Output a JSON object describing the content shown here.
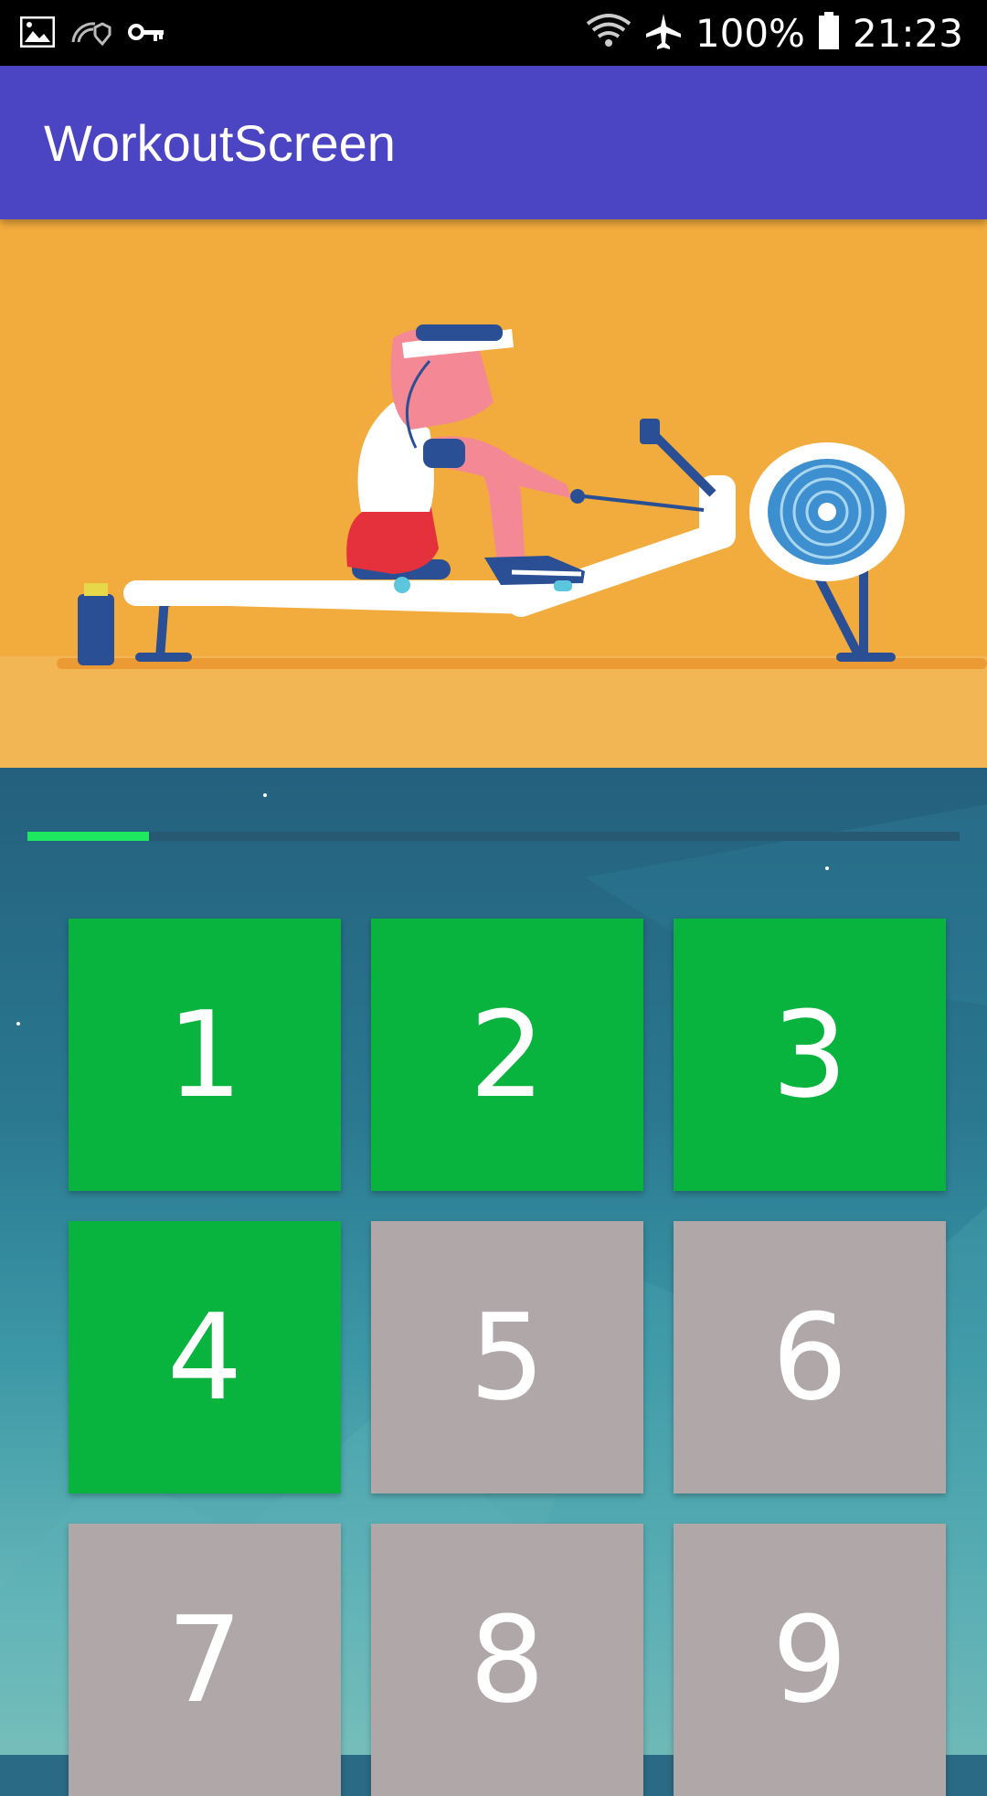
{
  "status_bar": {
    "battery": "100%",
    "time": "21:23",
    "icons": [
      "image-icon",
      "wifi-call-icon",
      "vpn-key-icon",
      "wifi-icon",
      "airplane-icon",
      "battery-icon"
    ]
  },
  "app_bar": {
    "title": "WorkoutScreen",
    "color": "#4b44c3"
  },
  "illustration": {
    "subject": "person-on-rowing-machine-illustration"
  },
  "progress": {
    "fraction": 0.13,
    "color": "#1ee860"
  },
  "tiles": [
    {
      "label": "1",
      "state": "done"
    },
    {
      "label": "2",
      "state": "done"
    },
    {
      "label": "3",
      "state": "done"
    },
    {
      "label": "4",
      "state": "done"
    },
    {
      "label": "5",
      "state": "todo"
    },
    {
      "label": "6",
      "state": "todo"
    },
    {
      "label": "7",
      "state": "todo"
    },
    {
      "label": "8",
      "state": "todo"
    },
    {
      "label": "9",
      "state": "todo"
    }
  ],
  "colors": {
    "done": "#08b33e",
    "todo": "#b0a8a8"
  }
}
